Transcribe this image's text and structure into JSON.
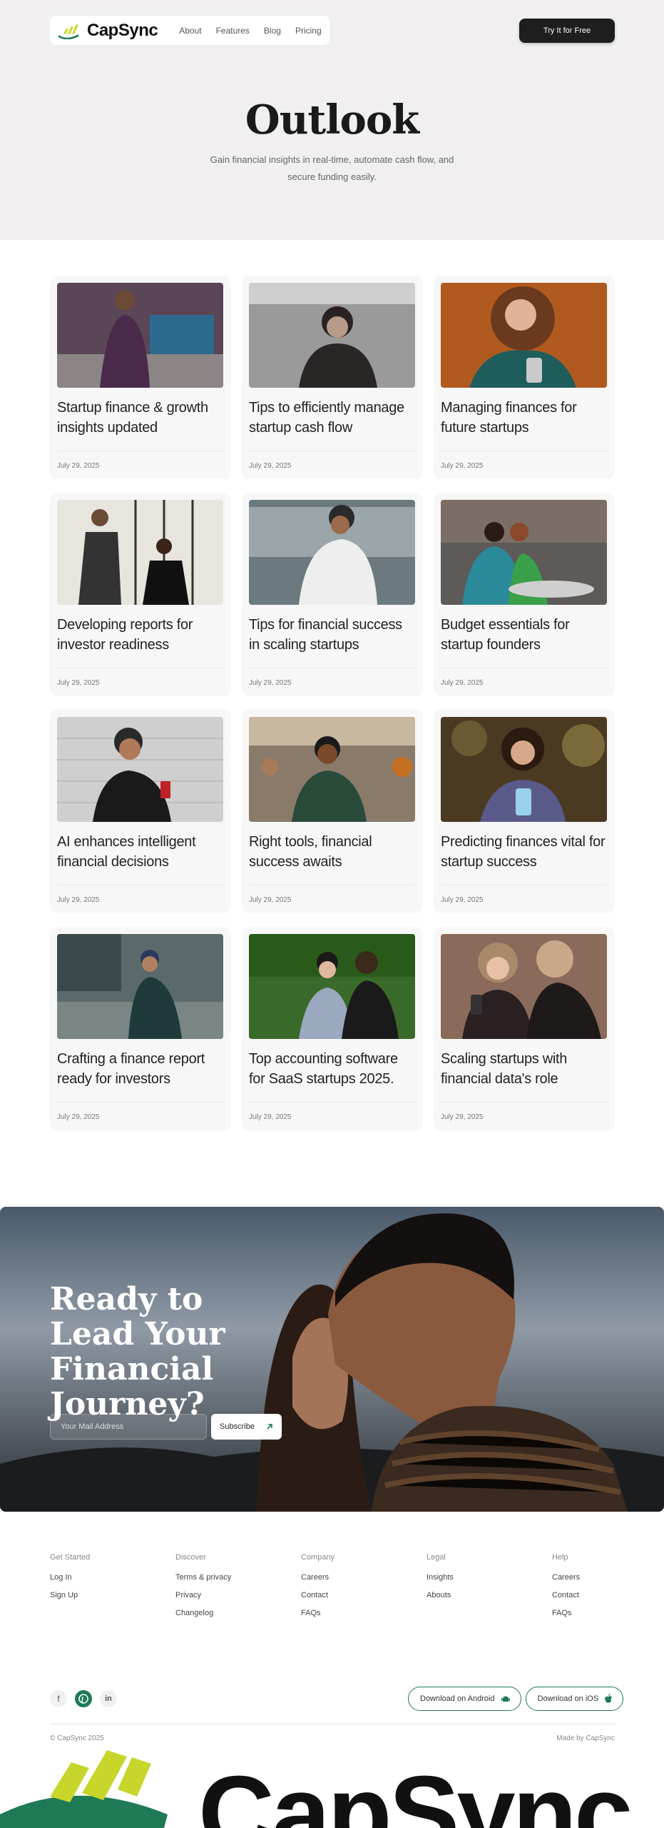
{
  "nav": {
    "brand": "CapSync",
    "links": [
      "About",
      "Features",
      "Blog",
      "Pricing"
    ],
    "cta": "Try It for Free"
  },
  "hero": {
    "title": "Outlook",
    "subtitle": "Gain financial insights in real-time, automate cash flow, and secure funding easily."
  },
  "posts": [
    {
      "title": "Startup finance & growth insights updated",
      "date": "July 29, 2025"
    },
    {
      "title": "Tips to efficiently manage startup cash flow",
      "date": "July 29, 2025"
    },
    {
      "title": "Managing finances for future startups",
      "date": "July 29, 2025"
    },
    {
      "title": "Developing reports for investor readiness",
      "date": "July 29, 2025"
    },
    {
      "title": "Tips for financial success in scaling startups",
      "date": "July 29, 2025"
    },
    {
      "title": "Budget essentials for startup founders",
      "date": "July 29, 2025"
    },
    {
      "title": "AI enhances intelligent financial decisions",
      "date": "July 29, 2025"
    },
    {
      "title": "Right tools, financial success awaits",
      "date": "July 29, 2025"
    },
    {
      "title": "Predicting finances vital for startup success",
      "date": "July 29, 2025"
    },
    {
      "title": "Crafting a finance report ready for investors",
      "date": "July 29, 2025"
    },
    {
      "title": "Top accounting software for SaaS startups 2025.",
      "date": "July 29, 2025"
    },
    {
      "title": "Scaling startups with financial data's role",
      "date": "July 29, 2025"
    }
  ],
  "banner": {
    "title": "Ready to Lead Your Financial Journey?",
    "email_placeholder": "Your Mail Address",
    "subscribe": "Subscribe"
  },
  "footer": {
    "columns": [
      {
        "heading": "Get Started",
        "links": [
          "Log In",
          "Sign Up"
        ]
      },
      {
        "heading": "Discover",
        "links": [
          "Terms & privacy",
          "Privacy",
          "Changelog"
        ]
      },
      {
        "heading": "Company",
        "links": [
          "Careers",
          "Contact",
          "FAQs"
        ]
      },
      {
        "heading": "Legal",
        "links": [
          "Insights",
          "Abouts"
        ]
      },
      {
        "heading": "Help",
        "links": [
          "Careers",
          "Contact",
          "FAQs"
        ]
      }
    ],
    "android": "Download on Android",
    "ios": "Download on iOS",
    "copyright": "© CapSync 2025",
    "made_by": "Made by CapSync",
    "big_brand": "CapSync"
  },
  "colors": {
    "accent_green": "#1d7a55",
    "accent_lime": "#c8d62b",
    "dark": "#1e1e1e"
  },
  "icons": [
    "facebook-icon",
    "pinterest-icon",
    "linkedin-icon",
    "android-icon",
    "apple-icon",
    "arrow-up-right-icon"
  ]
}
